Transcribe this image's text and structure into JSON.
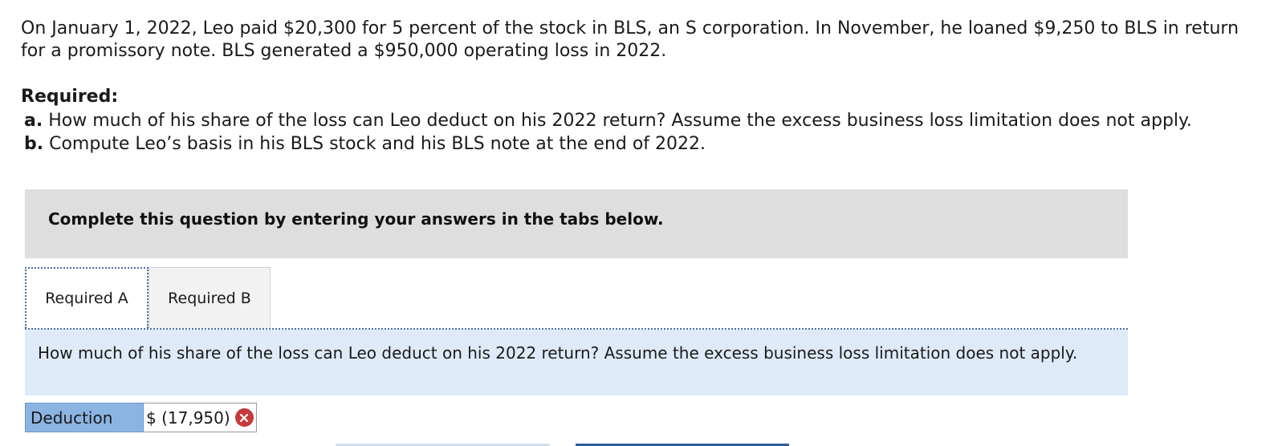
{
  "problem": {
    "intro": "On January 1, 2022, Leo paid $20,300 for 5 percent of the stock in BLS, an S corporation. In November, he loaned $9,250 to BLS in return for a promissory note. BLS generated a $950,000 operating loss in 2022.",
    "required_title": "Required:",
    "items": [
      {
        "letter": "a.",
        "text": "How much of his share of the loss can Leo deduct on his 2022 return? Assume the excess business loss limitation does not apply."
      },
      {
        "letter": "b.",
        "text": "Compute Leo’s basis in his BLS stock and his BLS note at the end of 2022."
      }
    ]
  },
  "instruction": "Complete this question by entering your answers in the tabs below.",
  "tabs": [
    {
      "label": "Required A",
      "active": true
    },
    {
      "label": "Required B",
      "active": false
    }
  ],
  "question": "How much of his share of the loss can Leo deduct on his 2022 return? Assume the excess business loss limitation does not apply.",
  "answer": {
    "label": "Deduction",
    "value": "$ (17,950)",
    "status": "incorrect",
    "status_icon": "x-circle-icon",
    "status_color": "#c53a3a"
  },
  "colors": {
    "instruction_bg": "#dedede",
    "question_bg": "#deeaf7",
    "label_bg": "#8cb4e2",
    "next_button": "#2d5e9c"
  }
}
